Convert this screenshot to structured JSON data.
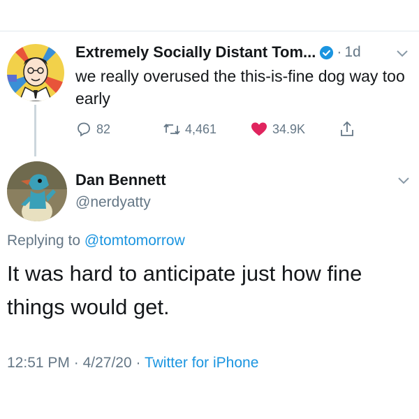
{
  "parent_tweet": {
    "display_name": "Extremely Socially Distant Tom...",
    "verified": true,
    "separator": "·",
    "time": "1d",
    "text": "we really overused the this-is-fine dog way too early",
    "actions": {
      "replies": "82",
      "retweets": "4,461",
      "likes": "34.9K"
    },
    "icons": [
      "verified-badge-icon",
      "chevron-down-icon",
      "reply-icon",
      "retweet-icon",
      "heart-icon",
      "share-icon"
    ]
  },
  "reply_tweet": {
    "display_name": "Dan Bennett",
    "handle": "@nerdyatty",
    "replying_prefix": "Replying to",
    "replying_mention": "@tomtomorrow",
    "text": "It was hard to anticipate just how fine things would get.",
    "time": "12:51 PM",
    "date": "4/27/20",
    "separator": "·",
    "source": "Twitter for iPhone"
  },
  "colors": {
    "text": "#14171a",
    "secondary": "#657786",
    "link": "#1b95e0",
    "like": "#e0245e",
    "divider": "#e1e8ed"
  }
}
